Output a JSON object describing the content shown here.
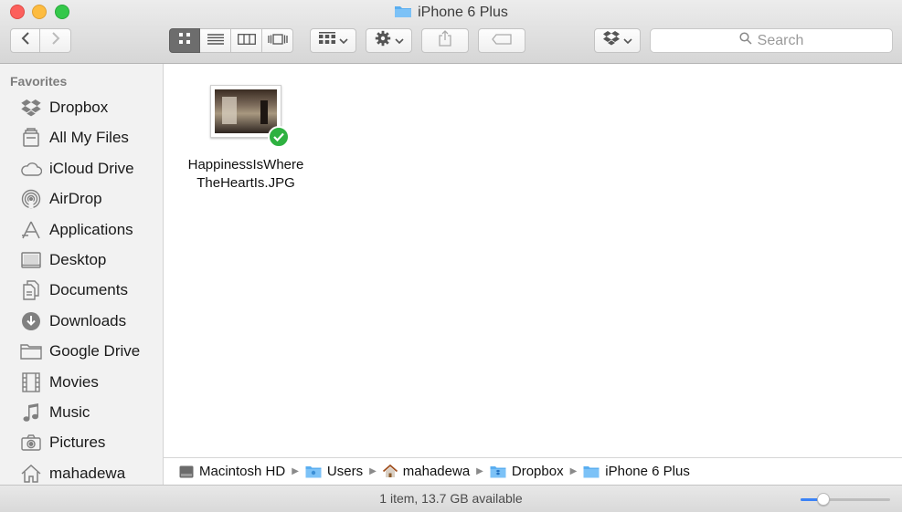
{
  "window": {
    "title": "iPhone 6 Plus",
    "title_icon": "folder-icon"
  },
  "toolbar": {
    "back_icon": "chevron-left-icon",
    "forward_icon": "chevron-right-icon",
    "view_modes": [
      "icon-view-icon",
      "list-view-icon",
      "column-view-icon",
      "cover-flow-icon"
    ],
    "active_view": "icon-view-icon",
    "arrange_icon": "arrange-icon",
    "action_icon": "gear-icon",
    "share_icon": "share-icon",
    "tag_icon": "tag-icon",
    "dropbox_icon": "dropbox-icon",
    "search_placeholder": "Search"
  },
  "sidebar": {
    "heading": "Favorites",
    "items": [
      {
        "label": "Dropbox",
        "icon": "dropbox-icon"
      },
      {
        "label": "All My Files",
        "icon": "all-files-icon"
      },
      {
        "label": "iCloud Drive",
        "icon": "cloud-icon"
      },
      {
        "label": "AirDrop",
        "icon": "airdrop-icon"
      },
      {
        "label": "Applications",
        "icon": "applications-icon"
      },
      {
        "label": "Desktop",
        "icon": "desktop-icon"
      },
      {
        "label": "Documents",
        "icon": "documents-icon"
      },
      {
        "label": "Downloads",
        "icon": "downloads-icon"
      },
      {
        "label": "Google Drive",
        "icon": "folder-icon"
      },
      {
        "label": "Movies",
        "icon": "movies-icon"
      },
      {
        "label": "Music",
        "icon": "music-icon"
      },
      {
        "label": "Pictures",
        "icon": "camera-icon"
      },
      {
        "label": "mahadewa",
        "icon": "home-icon"
      }
    ]
  },
  "files": [
    {
      "name_line1": "HappinessIsWhere",
      "name_line2": "TheHeartIs.JPG",
      "sync_status": "synced"
    }
  ],
  "path": {
    "segments": [
      {
        "label": "Macintosh HD",
        "icon": "hard-drive-icon"
      },
      {
        "label": "Users",
        "icon": "folder-icon"
      },
      {
        "label": "mahadewa",
        "icon": "home-icon"
      },
      {
        "label": "Dropbox",
        "icon": "dropbox-folder-icon"
      },
      {
        "label": "iPhone 6 Plus",
        "icon": "folder-icon"
      }
    ]
  },
  "status": {
    "text": "1 item, 13.7 GB available",
    "icon_size_level": 0.25
  },
  "colors": {
    "accent": "#3b82f6",
    "sync_green": "#2eb140",
    "folder_blue": "#5aaef0"
  }
}
